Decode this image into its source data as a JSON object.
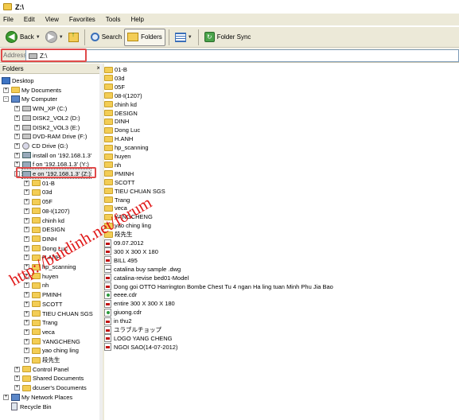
{
  "window": {
    "title": "Z:\\"
  },
  "menu": [
    "File",
    "Edit",
    "View",
    "Favorites",
    "Tools",
    "Help"
  ],
  "toolbar": {
    "back": "Back",
    "search": "Search",
    "folders": "Folders",
    "foldersync": "Folder Sync"
  },
  "address": {
    "label": "Address",
    "value": "Z:\\"
  },
  "tree": {
    "header": "Folders",
    "close": "×",
    "nodes": [
      {
        "label": "Desktop",
        "icon": "desktop-icon",
        "depth": 0,
        "exp": ""
      },
      {
        "label": "My Documents",
        "icon": "folder-icon",
        "depth": 1,
        "exp": "+"
      },
      {
        "label": "My Computer",
        "icon": "computer-icon",
        "depth": 1,
        "exp": "-"
      },
      {
        "label": "WIN_XP (C:)",
        "icon": "drive-icon",
        "depth": 2,
        "exp": "+"
      },
      {
        "label": "DISK2_VOL2 (D:)",
        "icon": "drive-icon",
        "depth": 2,
        "exp": "+"
      },
      {
        "label": "DISK2_VOL3 (E:)",
        "icon": "drive-icon",
        "depth": 2,
        "exp": "+"
      },
      {
        "label": "DVD-RAM Drive (F:)",
        "icon": "dvd-icon",
        "depth": 2,
        "exp": "+"
      },
      {
        "label": "CD Drive (G:)",
        "icon": "cd-icon",
        "depth": 2,
        "exp": "+"
      },
      {
        "label": "install on '192.168.1.3'",
        "icon": "network-drive-icon",
        "depth": 2,
        "exp": "+"
      },
      {
        "label": "f on '192.168.1.3' (Y:)",
        "icon": "network-drive-icon",
        "depth": 2,
        "exp": "+"
      },
      {
        "label": "e on '192.168.1.3' (Z:)",
        "icon": "network-drive-icon",
        "depth": 2,
        "exp": "-"
      },
      {
        "label": "01-B",
        "icon": "folder-icon",
        "depth": 3,
        "exp": "+"
      },
      {
        "label": "03d",
        "icon": "folder-icon",
        "depth": 3,
        "exp": "+"
      },
      {
        "label": "05F",
        "icon": "folder-icon",
        "depth": 3,
        "exp": "+"
      },
      {
        "label": "08-I(1207)",
        "icon": "folder-icon",
        "depth": 3,
        "exp": "+"
      },
      {
        "label": "chinh kd",
        "icon": "folder-icon",
        "depth": 3,
        "exp": "+"
      },
      {
        "label": "DESIGN",
        "icon": "folder-icon",
        "depth": 3,
        "exp": "+"
      },
      {
        "label": "DINH",
        "icon": "folder-icon",
        "depth": 3,
        "exp": "+"
      },
      {
        "label": "Dong Luc",
        "icon": "folder-icon",
        "depth": 3,
        "exp": "+"
      },
      {
        "label": "H.ANH",
        "icon": "folder-icon",
        "depth": 3,
        "exp": "+"
      },
      {
        "label": "hp_scanning",
        "icon": "folder-icon",
        "depth": 3,
        "exp": "+"
      },
      {
        "label": "huyen",
        "icon": "folder-icon",
        "depth": 3,
        "exp": "+"
      },
      {
        "label": "nh",
        "icon": "folder-icon",
        "depth": 3,
        "exp": "+"
      },
      {
        "label": "PMINH",
        "icon": "folder-icon",
        "depth": 3,
        "exp": "+"
      },
      {
        "label": "SCOTT",
        "icon": "folder-icon",
        "depth": 3,
        "exp": "+"
      },
      {
        "label": "TIEU CHUAN SGS",
        "icon": "folder-icon",
        "depth": 3,
        "exp": "+"
      },
      {
        "label": "Trang",
        "icon": "folder-icon",
        "depth": 3,
        "exp": "+"
      },
      {
        "label": "veca",
        "icon": "folder-icon",
        "depth": 3,
        "exp": "+"
      },
      {
        "label": "YANGCHENG",
        "icon": "folder-icon",
        "depth": 3,
        "exp": "+"
      },
      {
        "label": "yao ching ling",
        "icon": "folder-icon",
        "depth": 3,
        "exp": "+"
      },
      {
        "label": "段先生",
        "icon": "folder-icon",
        "depth": 3,
        "exp": "+"
      },
      {
        "label": "Control Panel",
        "icon": "folder-icon",
        "depth": 2,
        "exp": "+"
      },
      {
        "label": "Shared Documents",
        "icon": "folder-icon",
        "depth": 2,
        "exp": "+"
      },
      {
        "label": "dcuser's Documents",
        "icon": "folder-icon",
        "depth": 2,
        "exp": "+"
      },
      {
        "label": "My Network Places",
        "icon": "network-icon",
        "depth": 1,
        "exp": "+"
      },
      {
        "label": "Recycle Bin",
        "icon": "recycle-bin-icon",
        "depth": 1,
        "exp": ""
      }
    ]
  },
  "files": [
    {
      "name": "01-B",
      "icon": "folder-icon"
    },
    {
      "name": "03d",
      "icon": "folder-icon"
    },
    {
      "name": "05F",
      "icon": "folder-icon"
    },
    {
      "name": "08-I(1207)",
      "icon": "folder-icon"
    },
    {
      "name": "chinh kd",
      "icon": "folder-icon"
    },
    {
      "name": "DESIGN",
      "icon": "folder-icon"
    },
    {
      "name": "DINH",
      "icon": "folder-icon"
    },
    {
      "name": "Dong Luc",
      "icon": "folder-icon"
    },
    {
      "name": "H.ANH",
      "icon": "folder-icon"
    },
    {
      "name": "hp_scanning",
      "icon": "folder-icon"
    },
    {
      "name": "huyen",
      "icon": "folder-icon"
    },
    {
      "name": "nh",
      "icon": "folder-icon"
    },
    {
      "name": "PMINH",
      "icon": "folder-icon"
    },
    {
      "name": "SCOTT",
      "icon": "folder-icon"
    },
    {
      "name": "TIEU CHUAN SGS",
      "icon": "folder-icon"
    },
    {
      "name": "Trang",
      "icon": "folder-icon"
    },
    {
      "name": "veca",
      "icon": "folder-icon"
    },
    {
      "name": "YANGCHENG",
      "icon": "folder-icon"
    },
    {
      "name": "yao ching ling",
      "icon": "folder-icon"
    },
    {
      "name": "段先生",
      "icon": "folder-icon"
    },
    {
      "name": "09.07.2012",
      "icon": "pdf-icon"
    },
    {
      "name": "300 X 300 X 180",
      "icon": "pdf-icon"
    },
    {
      "name": "BILL 495",
      "icon": "pdf-icon"
    },
    {
      "name": "catalina buy sample .dwg",
      "icon": "dwg-icon"
    },
    {
      "name": "catalina-revise bed01-Model",
      "icon": "pdf-icon"
    },
    {
      "name": "Dong goi OTTO Harrington Bombe Chest Tu 4 ngan Ha ling tuan Minh Phu Jia Bao",
      "icon": "pdf-icon"
    },
    {
      "name": "eeee.cdr",
      "icon": "cdr-icon"
    },
    {
      "name": "entire 300 X 300 X 180",
      "icon": "pdf-icon"
    },
    {
      "name": "giuong.cdr",
      "icon": "cdr-icon"
    },
    {
      "name": "in thu2",
      "icon": "pdf-icon"
    },
    {
      "name": "ユラブルチョップ",
      "icon": "pdf-icon"
    },
    {
      "name": "LOGO YANG CHENG",
      "icon": "pdf-icon"
    },
    {
      "name": "NGOI SAO(14-07-2012)",
      "icon": "pdf-icon"
    }
  ],
  "watermark": "http://buidinh.net/forum",
  "colors": {
    "chrome": "#ece9d8",
    "highlight": "#e04a4a",
    "folder": "#f3cd55",
    "watermark": "#e01818"
  }
}
